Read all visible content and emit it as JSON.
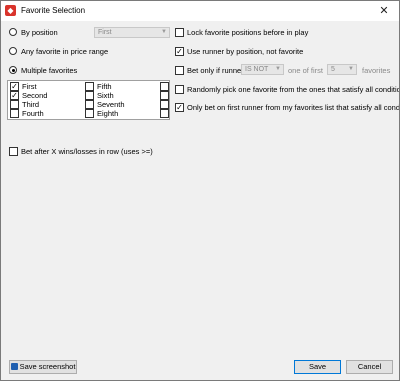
{
  "window": {
    "title": "Favorite Selection",
    "close_glyph": "✕"
  },
  "left": {
    "by_position": {
      "label": "By position",
      "selected": false,
      "combo_value": "First"
    },
    "any_favorite": {
      "label": "Any favorite in price range",
      "selected": false
    },
    "multiple_favorites": {
      "label": "Multiple favorites",
      "selected": true
    },
    "favorites": [
      {
        "label": "First",
        "checked": true
      },
      {
        "label": "Fifth",
        "checked": false
      },
      {
        "label": "",
        "checked": false
      },
      {
        "label": "Second",
        "checked": true
      },
      {
        "label": "Sixth",
        "checked": false
      },
      {
        "label": "",
        "checked": false
      },
      {
        "label": "Third",
        "checked": false
      },
      {
        "label": "Seventh",
        "checked": false
      },
      {
        "label": "",
        "checked": false
      },
      {
        "label": "Fourth",
        "checked": false
      },
      {
        "label": "Eighth",
        "checked": false
      },
      {
        "label": "",
        "checked": false
      }
    ],
    "bet_after": {
      "label": "Bet after X wins/losses in row (uses >=)",
      "checked": false
    }
  },
  "right": {
    "lock_positions": {
      "label": "Lock favorite positions before in play",
      "checked": false
    },
    "use_runner": {
      "label": "Use runner by position, not favorite",
      "checked": true
    },
    "bet_only_if": {
      "label": "Bet only if runner",
      "checked": false,
      "combo1_value": "IS NOT",
      "mid_label": "one of first",
      "combo2_value": "5",
      "end_label": "favorites"
    },
    "random_pick": {
      "label": "Randomly pick one favorite from the ones that satisfy all conditions",
      "checked": false
    },
    "only_first": {
      "label": "Only bet on first runner from my favorites list that satisfy all conditions",
      "checked": true
    }
  },
  "footer": {
    "save_screenshot_label": "Save screenshot",
    "save_label": "Save",
    "cancel_label": "Cancel"
  },
  "colors": {
    "accent": "#0078d7",
    "app_icon": "#d9332b"
  }
}
